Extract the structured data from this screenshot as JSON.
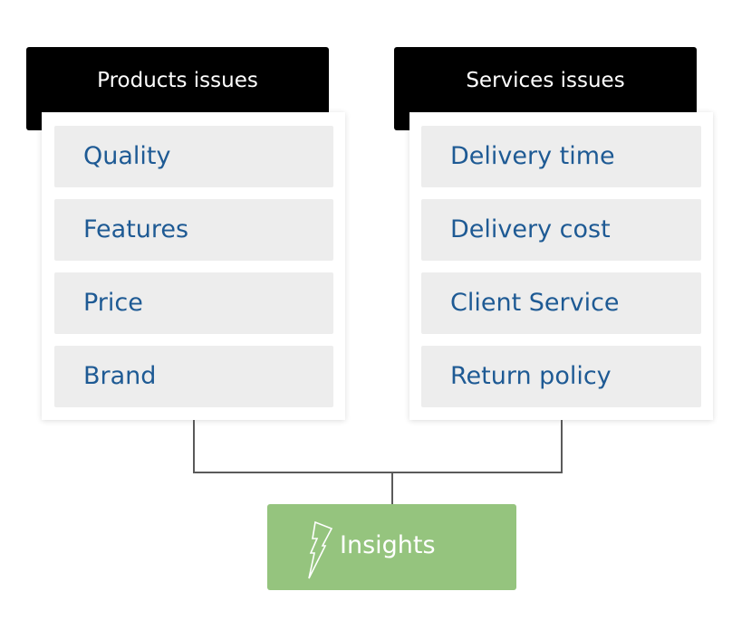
{
  "groups": [
    {
      "title": "Products issues",
      "items": [
        "Quality",
        "Features",
        "Price",
        "Brand"
      ]
    },
    {
      "title": "Services issues",
      "items": [
        "Delivery time",
        "Delivery cost",
        "Client Service",
        "Return policy"
      ]
    }
  ],
  "result": {
    "label": "Insights",
    "icon": "lightning-bolt-icon"
  },
  "colors": {
    "header_bg": "#000000",
    "item_bg": "#ededed",
    "item_text": "#1e5a94",
    "result_bg": "#95c47e",
    "connector": "#5a5a5a"
  }
}
